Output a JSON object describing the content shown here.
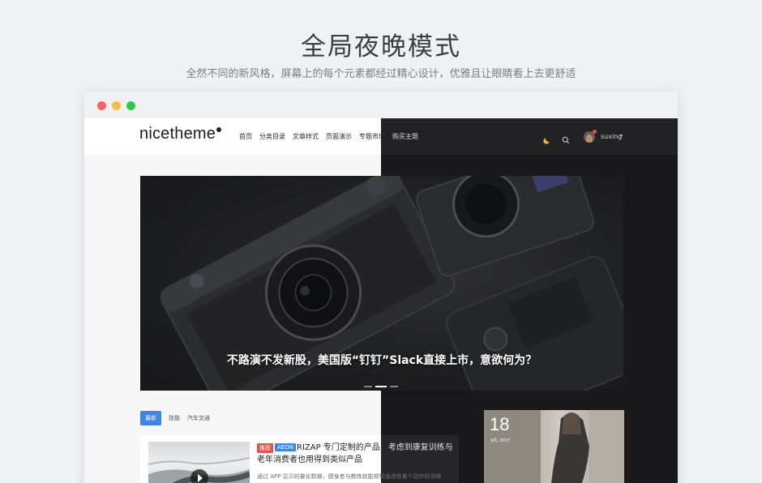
{
  "promo": {
    "title": "全局夜晚模式",
    "subtitle": "全然不同的新风格，屏幕上的每个元素都经过精心设计，优雅且让眼睛看上去更舒适"
  },
  "site": {
    "logo": "nicetheme",
    "nav": [
      "首页",
      "分类目录",
      "文章样式",
      "页面演示",
      "专题市场",
      "购买主题"
    ],
    "user": {
      "name": "suxing"
    }
  },
  "hero": {
    "caption": "不路演不发新股，美国版“钉钉”Slack直接上市，意欲何为？",
    "slide_count": 3,
    "active_slide": 2
  },
  "tabs": [
    "最新",
    "技能",
    "汽车交通"
  ],
  "post": {
    "badges": [
      "推荐",
      "AEON"
    ],
    "title_light": "RIZAP 专门定制的产品，",
    "title_dark": "考虑到康复训练与",
    "title_line2": "老年消费者也用得到类似产品",
    "excerpt": "通过 APP 显示的量化数据，健身者与教练就能够知道进练某个动作的训练"
  },
  "side_card": {
    "day": "18",
    "month": "9月, 2017"
  },
  "colors": {
    "accent": "#3d86e4",
    "badge_red": "#e2544b",
    "moon": "#f5b731",
    "dark_bg": "#19191b"
  }
}
